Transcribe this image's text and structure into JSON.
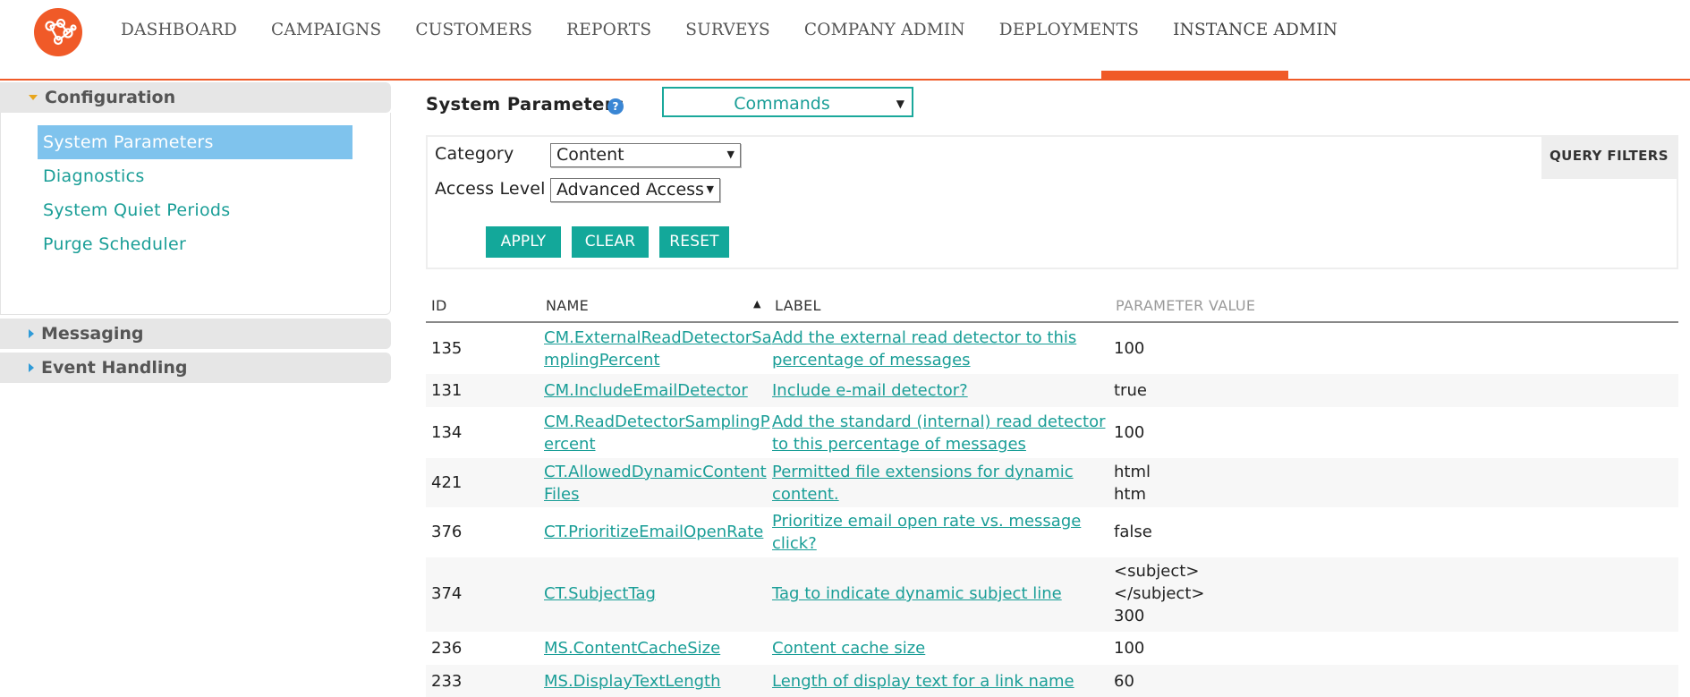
{
  "nav": {
    "items": [
      "DASHBOARD",
      "CAMPAIGNS",
      "CUSTOMERS",
      "REPORTS",
      "SURVEYS",
      "COMPANY ADMIN",
      "DEPLOYMENTS",
      "INSTANCE ADMIN"
    ],
    "active": "INSTANCE ADMIN"
  },
  "sidebar": {
    "sections": [
      {
        "title": "Configuration",
        "expanded": true,
        "items": [
          "System Parameters",
          "Diagnostics",
          "System Quiet Periods",
          "Purge Scheduler"
        ],
        "selected": "System Parameters"
      },
      {
        "title": "Messaging",
        "expanded": false
      },
      {
        "title": "Event Handling",
        "expanded": false
      }
    ]
  },
  "main": {
    "title": "System Parameters",
    "help_icon": "?",
    "command_select": {
      "value": "Commands",
      "arrow": "▼"
    },
    "filters": {
      "category_label": "Category",
      "category_value": "Content",
      "access_label": "Access Level",
      "access_value": "Advanced Access",
      "arrow": "▼",
      "buttons": {
        "apply": "APPLY",
        "clear": "CLEAR",
        "reset": "RESET"
      },
      "query_filters_tab": "QUERY FILTERS"
    },
    "table": {
      "headers": {
        "id": "ID",
        "name": "NAME",
        "label": "LABEL",
        "value": "PARAMETER VALUE"
      },
      "sort_indicator": "▲",
      "rows": [
        {
          "id": "135",
          "name": "CM.ExternalReadDetectorSamplingPercent",
          "label": "Add the external read detector to this percentage of messages",
          "value": "100"
        },
        {
          "id": "131",
          "name": "CM.IncludeEmailDetector",
          "label": "Include e-mail detector?",
          "value": "true"
        },
        {
          "id": "134",
          "name": "CM.ReadDetectorSamplingPercent",
          "label": "Add the standard (internal) read detector to this percentage of messages",
          "value": "100"
        },
        {
          "id": "421",
          "name": "CT.AllowedDynamicContentFiles",
          "label": "Permitted file extensions for dynamic content.",
          "value": "html\nhtm"
        },
        {
          "id": "376",
          "name": "CT.PrioritizeEmailOpenRate",
          "label": "Prioritize email open rate vs. message click?",
          "value": "false"
        },
        {
          "id": "374",
          "name": "CT.SubjectTag",
          "label": "Tag to indicate dynamic subject line",
          "value": "<subject>\n</subject>\n300"
        },
        {
          "id": "236",
          "name": "MS.ContentCacheSize",
          "label": "Content cache size",
          "value": "100"
        },
        {
          "id": "233",
          "name": "MS.DisplayTextLength",
          "label": "Length of display text for a link name",
          "value": "60"
        }
      ]
    }
  },
  "colors": {
    "accent": "#f05a28",
    "teal": "#13a89a",
    "link": "#1a9e97",
    "selected": "#7fc3ed"
  }
}
